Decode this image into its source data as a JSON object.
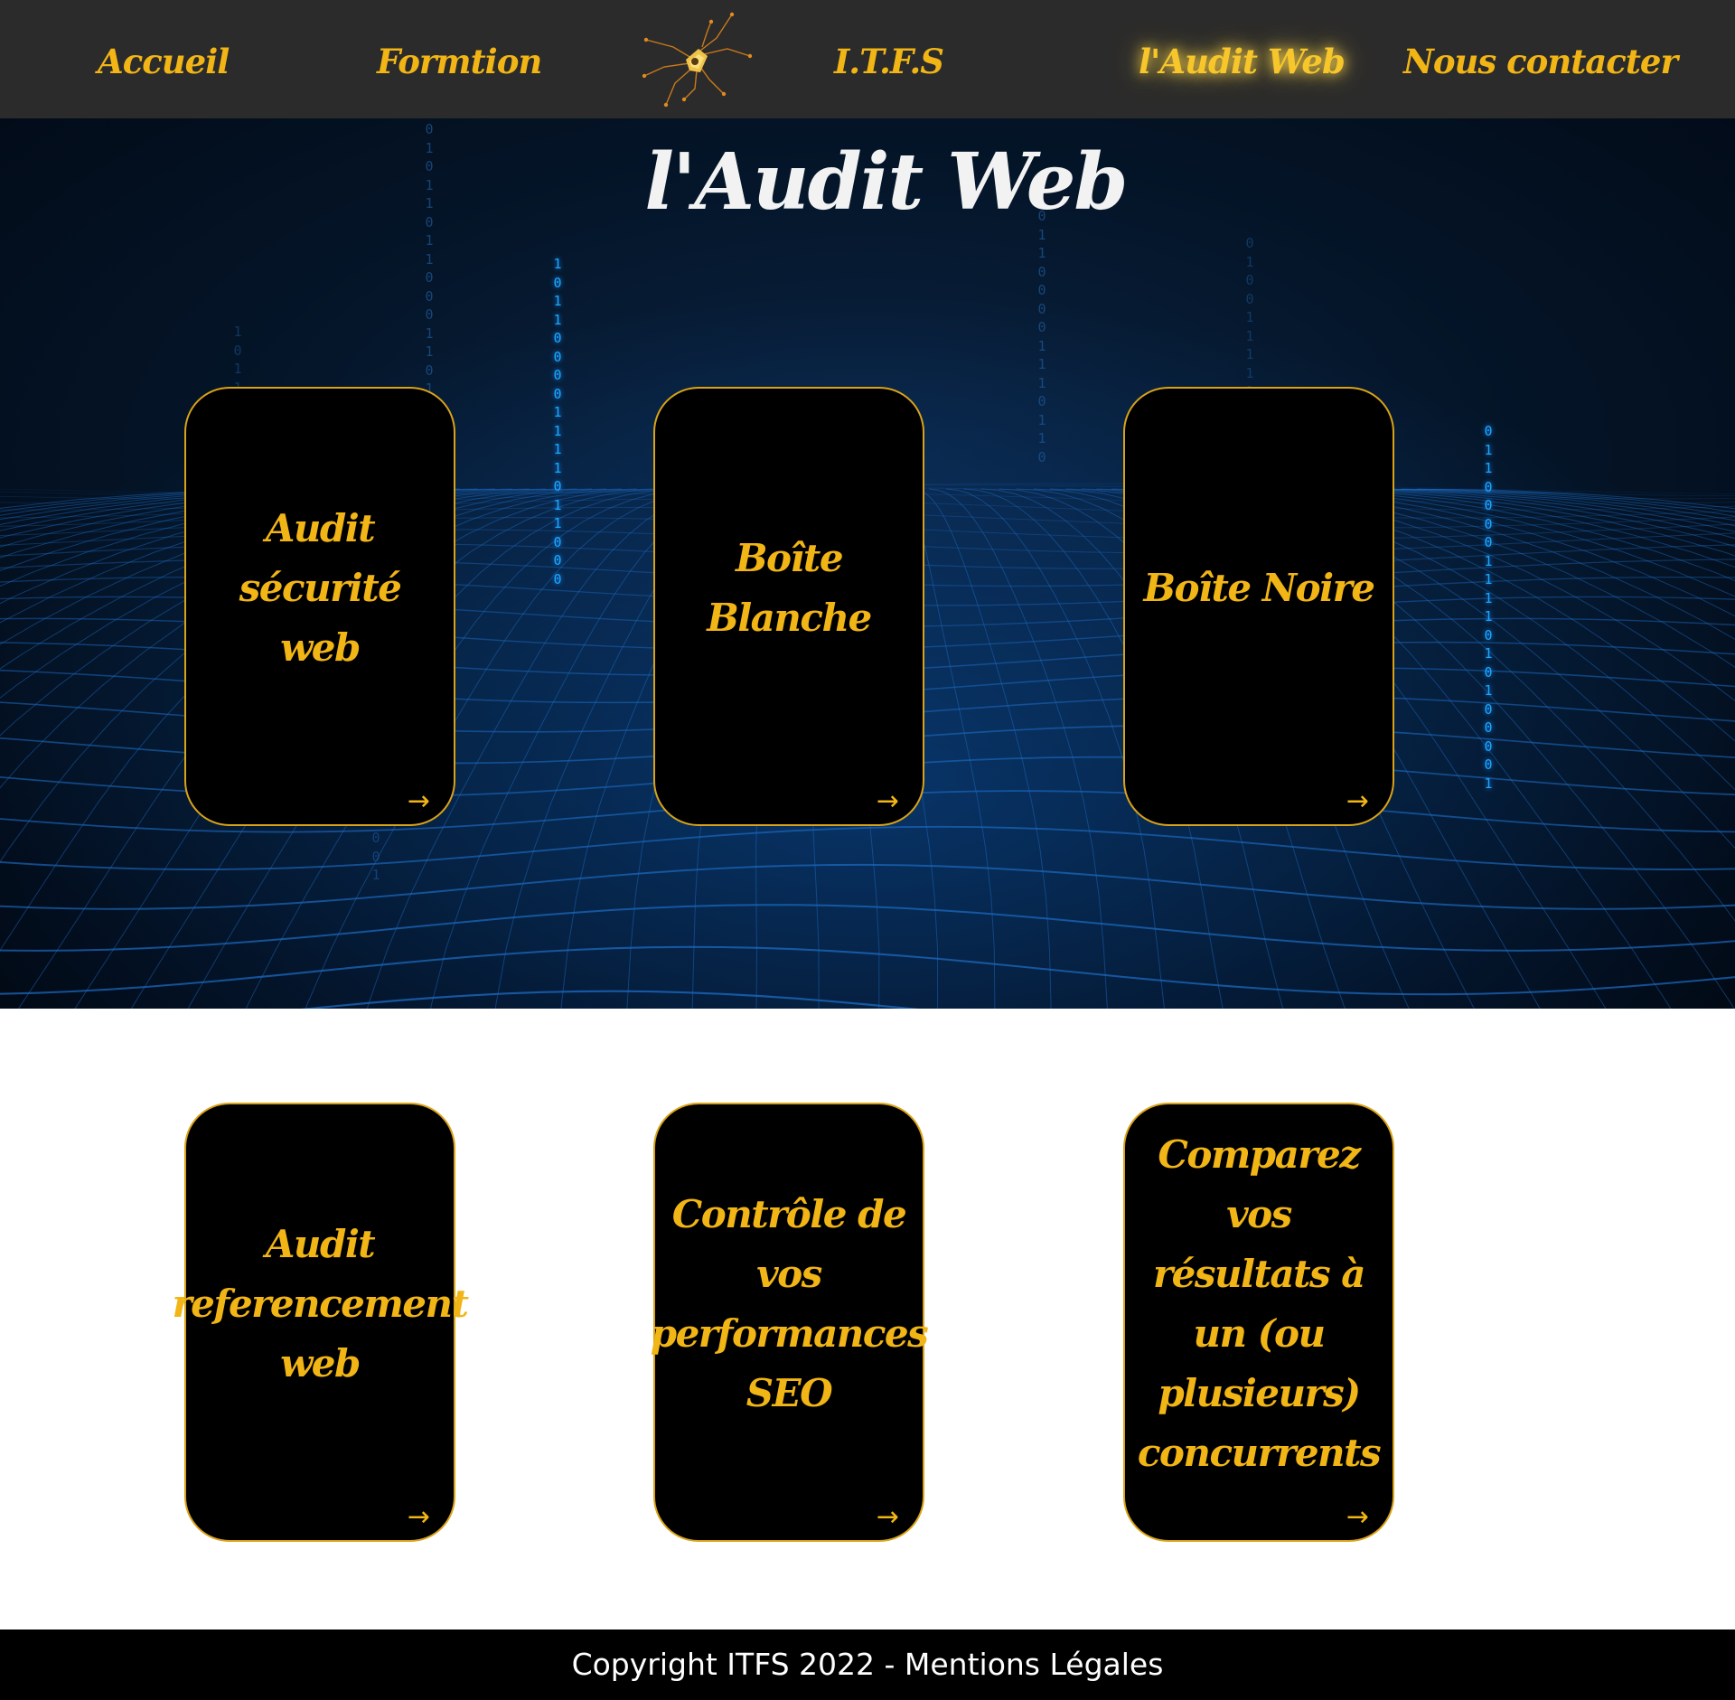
{
  "nav": {
    "items": [
      {
        "label": "Accueil"
      },
      {
        "label": "Formtion"
      },
      {
        "label": "I.T.F.S"
      },
      {
        "label": "l'Audit Web"
      },
      {
        "label": "Nous contacter"
      }
    ],
    "active": "l'Audit Web",
    "logo_icon": "spider-logo-icon"
  },
  "hero": {
    "title": "l'Audit Web"
  },
  "cards": [
    {
      "label": "Audit sécurité web",
      "arrow": "→"
    },
    {
      "label": "Boîte Blanche",
      "arrow": "→"
    },
    {
      "label": "Boîte Noire",
      "arrow": "→"
    },
    {
      "label": "Audit referencement web",
      "arrow": "→"
    },
    {
      "label": "Contrôle de vos performances SEO",
      "arrow": "→"
    },
    {
      "label": "Comparez vos résultats à un (ou plusieurs) concurrents",
      "arrow": "→"
    }
  ],
  "footer": {
    "text": "Copyright ITFS 2022 - Mentions Légales"
  },
  "colors": {
    "accent": "#f2b516",
    "nav_bg": "#2b2b2b",
    "card_bg": "#000000",
    "footer_bg": "#000000",
    "hero_bg": "#041427",
    "grid": "#1e6ec8"
  }
}
